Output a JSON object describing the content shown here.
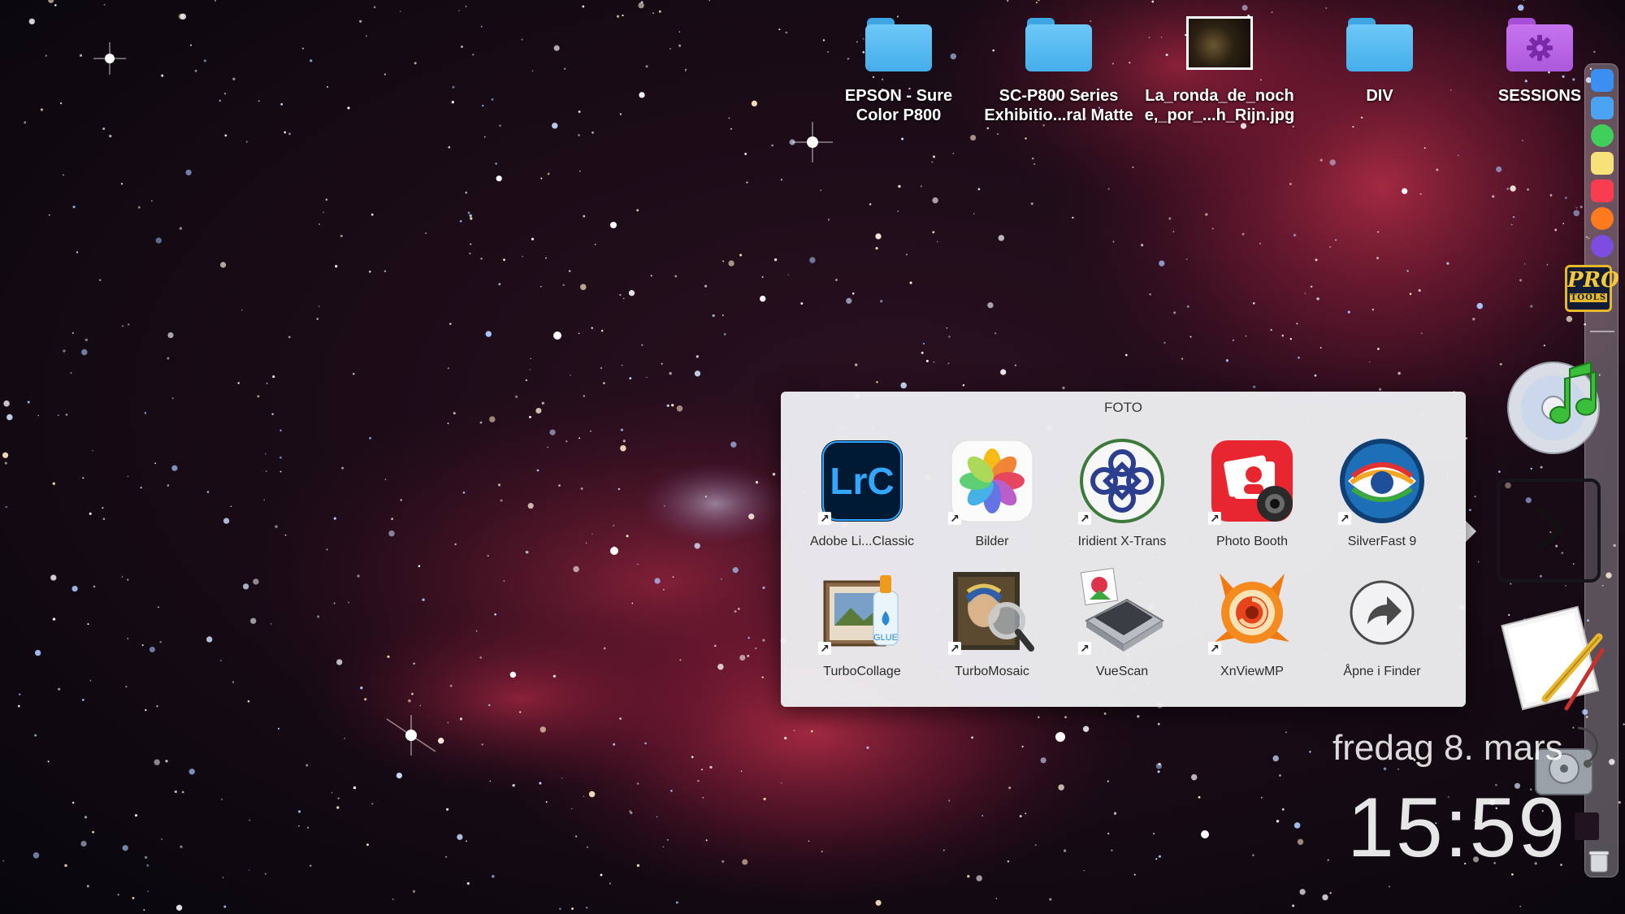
{
  "desktop": {
    "icons": [
      {
        "name": "EPSON - Sure\nColor P800",
        "kind": "folder",
        "color": "#5bbcf2"
      },
      {
        "name": "SC-P800 Series\nExhibitio...ral Matte",
        "kind": "folder",
        "color": "#5bbcf2"
      },
      {
        "name": "La_ronda_de_noch\ne,_por_...h_Rijn.jpg",
        "kind": "image"
      },
      {
        "name": "DIV",
        "kind": "folder",
        "color": "#5bbcf2"
      },
      {
        "name": "SESSIONS",
        "kind": "folder-gear",
        "color": "#bd68e8"
      }
    ]
  },
  "stack": {
    "title": "FOTO",
    "apps": [
      {
        "label": "Adobe Li...Classic",
        "icon": "lightroom-classic-icon",
        "alias": true
      },
      {
        "label": "Bilder",
        "icon": "photos-icon",
        "alias": true
      },
      {
        "label": "Iridient X-Trans",
        "icon": "iridient-icon",
        "alias": true
      },
      {
        "label": "Photo Booth",
        "icon": "photo-booth-icon",
        "alias": true
      },
      {
        "label": "SilverFast 9",
        "icon": "silverfast-icon",
        "alias": true
      },
      {
        "label": "TurboCollage",
        "icon": "turbocollage-icon",
        "alias": true
      },
      {
        "label": "TurboMosaic",
        "icon": "turbomosaic-icon",
        "alias": true
      },
      {
        "label": "VueScan",
        "icon": "vuescan-icon",
        "alias": true
      },
      {
        "label": "XnViewMP",
        "icon": "xnviewmp-icon",
        "alias": true
      },
      {
        "label": "Åpne i Finder",
        "icon": "open-in-finder-icon",
        "alias": false
      }
    ],
    "lightroom_text": "LrC",
    "glue_text": "GLUE"
  },
  "dock": {
    "protools_line1": "PRO",
    "protools_line2": "TOOLS",
    "colors": {
      "finder": "#3a8ff0",
      "mail": "#4aa3f3",
      "messages": "#3fcf5a",
      "notes": "#f7e27a",
      "music": "#fa3c50",
      "firefox": "#ff7a1c",
      "purple_app": "#7d4ce0"
    }
  },
  "widget": {
    "date": "fredag 8. mars",
    "time": "15:59"
  },
  "colors": {
    "accent_blue": "#1e90ff",
    "xnview_orange": "#f07a12",
    "photobooth_red": "#e8262f"
  }
}
